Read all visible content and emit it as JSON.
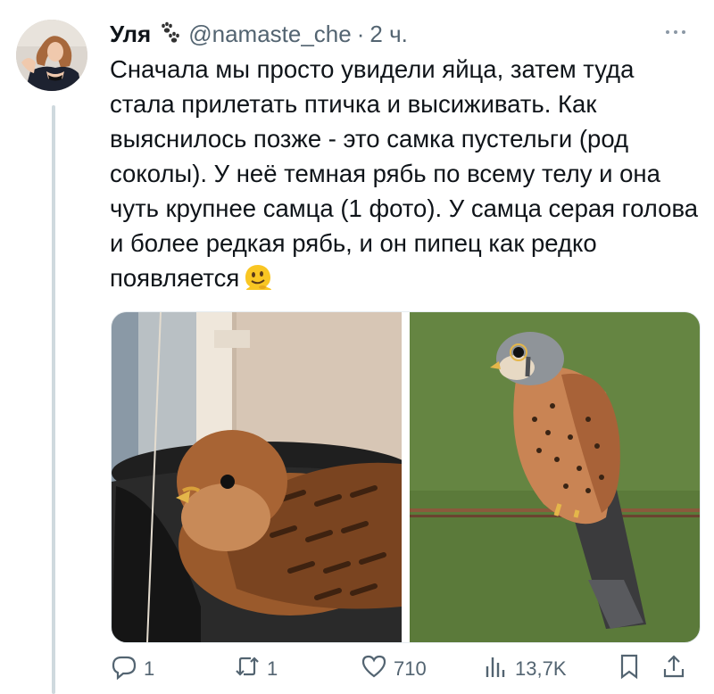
{
  "tweet": {
    "author_name": "Уля",
    "handle": "@namaste_che",
    "separator": "·",
    "time": "2 ч.",
    "text": "Сначала мы просто увидели яйца, затем туда стала прилетать птичка и высиживать. Как выяснилось позже - это самка пустельги (род соколы). У неё темная рябь по всему телу и она чуть крупнее самца (1 фото). У самца серая голова и более редкая рябь, и он пипец как редко появляется"
  },
  "actions": {
    "replies": "1",
    "reposts": "1",
    "likes": "710",
    "views": "13,7K"
  },
  "icons": {
    "badge": "paw-prints-icon",
    "emoji": "melting-face-icon",
    "more": "more-dots-icon",
    "reply": "reply-icon",
    "repost": "repost-icon",
    "like": "heart-icon",
    "views": "views-bar-icon",
    "bookmark": "bookmark-icon",
    "share": "share-icon"
  },
  "colors": {
    "text": "#0f1419",
    "secondary": "#536471",
    "thread_line": "#cfd9de"
  }
}
